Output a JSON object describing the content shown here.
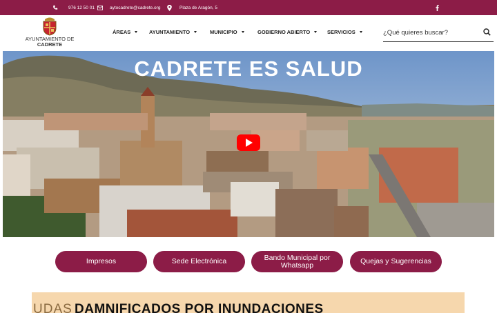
{
  "topbar": {
    "phone": "976 12 50 01",
    "email": "aytocadrete@cadrete.org",
    "address": "Plaza de Aragón, 5",
    "social_icon": "facebook-icon"
  },
  "logo": {
    "line1": "AYUNTAMIENTO DE",
    "line2": "CADRETE"
  },
  "nav": {
    "items": [
      {
        "label": "ÁREAS"
      },
      {
        "label": "AYUNTAMIENTO"
      },
      {
        "label": "MUNICIPIO"
      },
      {
        "label": "GOBIERNO ABIERTO"
      },
      {
        "label": "SERVICIOS"
      }
    ]
  },
  "search": {
    "placeholder": "¿Qué quieres buscar?"
  },
  "hero": {
    "title": "CADRETE ES SALUD"
  },
  "buttons": [
    {
      "label": "Impresos"
    },
    {
      "label": "Sede Electrónica"
    },
    {
      "label": "Bando Municipal por Whatsapp"
    },
    {
      "label": "Quejas y Sugerencias"
    }
  ],
  "banner": {
    "prefix": "UDAS",
    "title": "DAMNIFICADOS POR INUNDACIONES"
  },
  "colors": {
    "brand": "#8c1c47",
    "banner_bg": "#f6d7ad",
    "play": "#ff0000"
  }
}
